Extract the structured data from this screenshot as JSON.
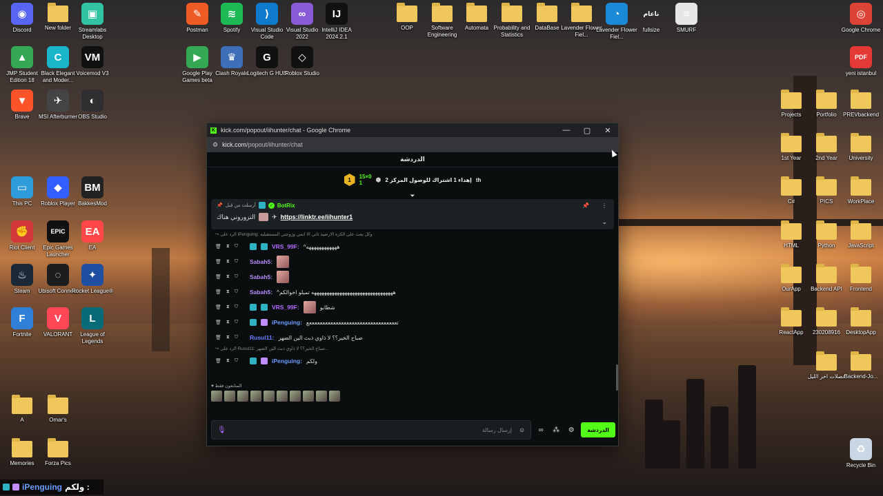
{
  "desktop": {
    "icons": [
      {
        "label": "Discord",
        "icon": "discord-icon",
        "color": "#5865f2",
        "glyph": "◉"
      },
      {
        "label": "New folder",
        "icon": "folder-icon"
      },
      {
        "label": "Streamlabs Desktop",
        "icon": "streamlabs-icon",
        "color": "#31c3a2",
        "glyph": "▣"
      },
      {
        "label": "Postman",
        "icon": "postman-icon",
        "color": "#ef5b25",
        "glyph": "✎"
      },
      {
        "label": "Spotify",
        "icon": "spotify-icon",
        "color": "#1db954",
        "glyph": "≋"
      },
      {
        "label": "Visual Studio Code",
        "icon": "vscode-icon",
        "color": "#0e7acc",
        "glyph": "⟩"
      },
      {
        "label": "Visual Studio 2022",
        "icon": "visual-studio-icon",
        "color": "#8a5bd6",
        "glyph": "∞"
      },
      {
        "label": "IntelliJ IDEA 2024.2.1",
        "icon": "intellij-icon",
        "color": "#111111",
        "glyph": "IJ"
      },
      {
        "label": "OOP",
        "icon": "folder-icon"
      },
      {
        "label": "Software Engineering",
        "icon": "folder-icon"
      },
      {
        "label": "Automata",
        "icon": "folder-icon"
      },
      {
        "label": "Probability and Statistics",
        "icon": "folder-icon"
      },
      {
        "label": "DataBase",
        "icon": "folder-icon"
      },
      {
        "label": "Lavender Flower Fiel...",
        "icon": "image-file-icon"
      },
      {
        "label": "Lavender Flower Fiel...",
        "icon": "edge-icon",
        "color": "#1b8ad6",
        "glyph": "◔"
      },
      {
        "label": "fullsize",
        "icon": "image-text-icon",
        "glyph": "ناعام"
      },
      {
        "label": "SMURF",
        "icon": "text-file-icon",
        "color": "#e6e6e6",
        "glyph": "≡"
      },
      {
        "label": "Google Chrome",
        "icon": "chrome-icon",
        "color": "#db4437",
        "glyph": "◎"
      },
      {
        "label": "JMP Student Edition 18",
        "icon": "jmp-icon",
        "color": "#35a853",
        "glyph": "▲"
      },
      {
        "label": "Black Elegant and Moder...",
        "icon": "canva-icon",
        "color": "#19b6c9",
        "glyph": "C"
      },
      {
        "label": "Voicemod V3",
        "icon": "voicemod-icon",
        "color": "#111111",
        "glyph": "VM"
      },
      {
        "label": "Google Play Games beta",
        "icon": "google-play-icon",
        "color": "#34a853",
        "glyph": "▶"
      },
      {
        "label": "Clash Royale",
        "icon": "clash-royale-icon",
        "color": "#3d6fb8",
        "glyph": "♛"
      },
      {
        "label": "Logitech G HUB",
        "icon": "logitech-icon",
        "color": "#111111",
        "glyph": "G"
      },
      {
        "label": "Roblox Studio",
        "icon": "roblox-studio-icon",
        "color": "#111111",
        "glyph": "◇"
      },
      {
        "label": "yeni istanbul",
        "icon": "pdf-icon",
        "color": "#e53935",
        "glyph": "PDF"
      },
      {
        "label": "Brave",
        "icon": "brave-icon",
        "color": "#fb542b",
        "glyph": "▼"
      },
      {
        "label": "MSI Afterburner",
        "icon": "msi-icon",
        "color": "#444444",
        "glyph": "✈"
      },
      {
        "label": "OBS Studio",
        "icon": "obs-icon",
        "color": "#302e31",
        "glyph": "◐"
      },
      {
        "label": "Projects",
        "icon": "folder-icon"
      },
      {
        "label": "Portfolio",
        "icon": "folder-icon"
      },
      {
        "label": "PREVbackend",
        "icon": "folder-icon"
      },
      {
        "label": "1st Year",
        "icon": "folder-icon"
      },
      {
        "label": "2nd Year",
        "icon": "folder-icon"
      },
      {
        "label": "University",
        "icon": "folder-icon"
      },
      {
        "label": "This PC",
        "icon": "this-pc-icon",
        "color": "#2d9cdb",
        "glyph": "▭"
      },
      {
        "label": "Roblox Player",
        "icon": "roblox-icon",
        "color": "#335fff",
        "glyph": "◆"
      },
      {
        "label": "BakkesMod",
        "icon": "bakkesmod-icon",
        "color": "#222222",
        "glyph": "BM"
      },
      {
        "label": "C#",
        "icon": "folder-icon"
      },
      {
        "label": "PICS",
        "icon": "folder-icon"
      },
      {
        "label": "WorkPlace",
        "icon": "folder-icon"
      },
      {
        "label": "Riot Client",
        "icon": "riot-icon",
        "color": "#d13639",
        "glyph": "✊"
      },
      {
        "label": "Epic Games Launcher",
        "icon": "epic-icon",
        "color": "#111111",
        "glyph": "EPIC"
      },
      {
        "label": "EA",
        "icon": "ea-icon",
        "color": "#ff4747",
        "glyph": "EA"
      },
      {
        "label": "HTML",
        "icon": "folder-icon"
      },
      {
        "label": "Python",
        "icon": "folder-icon"
      },
      {
        "label": "JavaScript",
        "icon": "folder-icon"
      },
      {
        "label": "Steam",
        "icon": "steam-icon",
        "color": "#1b2838",
        "glyph": "♨"
      },
      {
        "label": "Ubisoft Connect",
        "icon": "ubisoft-icon",
        "color": "#1d1d1d",
        "glyph": "◌"
      },
      {
        "label": "Rocket League®",
        "icon": "rocket-league-icon",
        "color": "#1e4fa1",
        "glyph": "✦"
      },
      {
        "label": "OurApp",
        "icon": "folder-icon"
      },
      {
        "label": "Backend API",
        "icon": "folder-icon"
      },
      {
        "label": "Frontend",
        "icon": "folder-icon"
      },
      {
        "label": "Fortnite",
        "icon": "fortnite-icon",
        "color": "#2f7fd6",
        "glyph": "F"
      },
      {
        "label": "VALORANT",
        "icon": "valorant-icon",
        "color": "#ff4655",
        "glyph": "V"
      },
      {
        "label": "League of Legends",
        "icon": "league-icon",
        "color": "#0a6b78",
        "glyph": "L"
      },
      {
        "label": "ReactApp",
        "icon": "folder-icon"
      },
      {
        "label": "230208916",
        "icon": "folder-icon"
      },
      {
        "label": "DesktopApp",
        "icon": "folder-icon"
      },
      {
        "label": "فصلات اخر الليل",
        "icon": "folder-icon"
      },
      {
        "label": "Backend-Jo...",
        "icon": "folder-icon"
      },
      {
        "label": "A",
        "icon": "folder-icon"
      },
      {
        "label": "Omar's",
        "icon": "folder-icon"
      },
      {
        "label": "Memories",
        "icon": "folder-icon"
      },
      {
        "label": "Forza Pics",
        "icon": "folder-icon"
      },
      {
        "label": "Recycle Bin",
        "icon": "recycle-bin-icon",
        "color": "#c9d6e3",
        "glyph": "♻"
      }
    ]
  },
  "window": {
    "title": "kick.com/popout/iihunter/chat - Google Chrome",
    "url_host": "kick.com",
    "url_path": "/popout/iihunter/chat",
    "controls": {
      "minimize": "—",
      "maximize": "▢",
      "close": "✕"
    }
  },
  "chat": {
    "header": "الدردشة",
    "goal": {
      "level": "1",
      "count_top": "15×0",
      "count_bottom": "1",
      "text": "إهداء 1 اشتراك للوصول المركز 2",
      "suffix": "th"
    },
    "pinned": {
      "sent_by": "أرسلت من قبل",
      "bot_name": "BotRix",
      "link": "https://linktr.ee/iihunter1",
      "tail": "التزوروني هناك"
    },
    "messages": [
      {
        "type": "reply",
        "text": "الرد على iPenguing: وكل يعث على الكره الارضيه ثاني الا انمي وزوجتي المستقبليه"
      },
      {
        "type": "msg",
        "user": "VRS_99F",
        "user_class": "u-vrs",
        "badges": [
          "kick",
          "kick"
        ],
        "text": "^ههههههههههههه"
      },
      {
        "type": "msg",
        "user": "Sabah5",
        "user_class": "u-sab",
        "badges": [],
        "text": "",
        "emote": true
      },
      {
        "type": "msg",
        "user": "Sabah5",
        "user_class": "u-sab",
        "badges": [],
        "text": "",
        "emote": true
      },
      {
        "type": "msg",
        "user": "Sabah5",
        "user_class": "u-sab",
        "badges": [],
        "text": "^ههههههههههههههههههههههههههههههههه تميلو اخوالكم"
      },
      {
        "type": "msg",
        "user": "VRS_99F",
        "user_class": "u-vrs",
        "badges": [
          "kick",
          "kick"
        ],
        "text": "شطابو",
        "emote": true
      },
      {
        "type": "msg",
        "user": "iPenguing",
        "user_class": "u-ipen",
        "badges": [
          "kick",
          "sub"
        ],
        "text": "تعععععععععععععععععععععععععععععععععع"
      },
      {
        "type": "msg",
        "user": "Rusul11",
        "user_class": "u-rus",
        "badges": [],
        "text": "صباح الخير؟؟ لا ذاوي ذبث الين الضهر"
      },
      {
        "type": "reply",
        "text": "الرد على Rusul11: صباح الخير؟؟ لا ذاوي ذبث الين الضهر..."
      },
      {
        "type": "msg",
        "user": "iPenguing",
        "user_class": "u-ipen",
        "badges": [
          "kick",
          "sub"
        ],
        "text": "ولكم"
      }
    ],
    "subscribers_label": "المتابعون فقط",
    "input_placeholder": "إرسال رسالة",
    "send_label": "الدردشة"
  },
  "overlay": {
    "user": "iPenguing",
    "text": "ولكم :"
  }
}
